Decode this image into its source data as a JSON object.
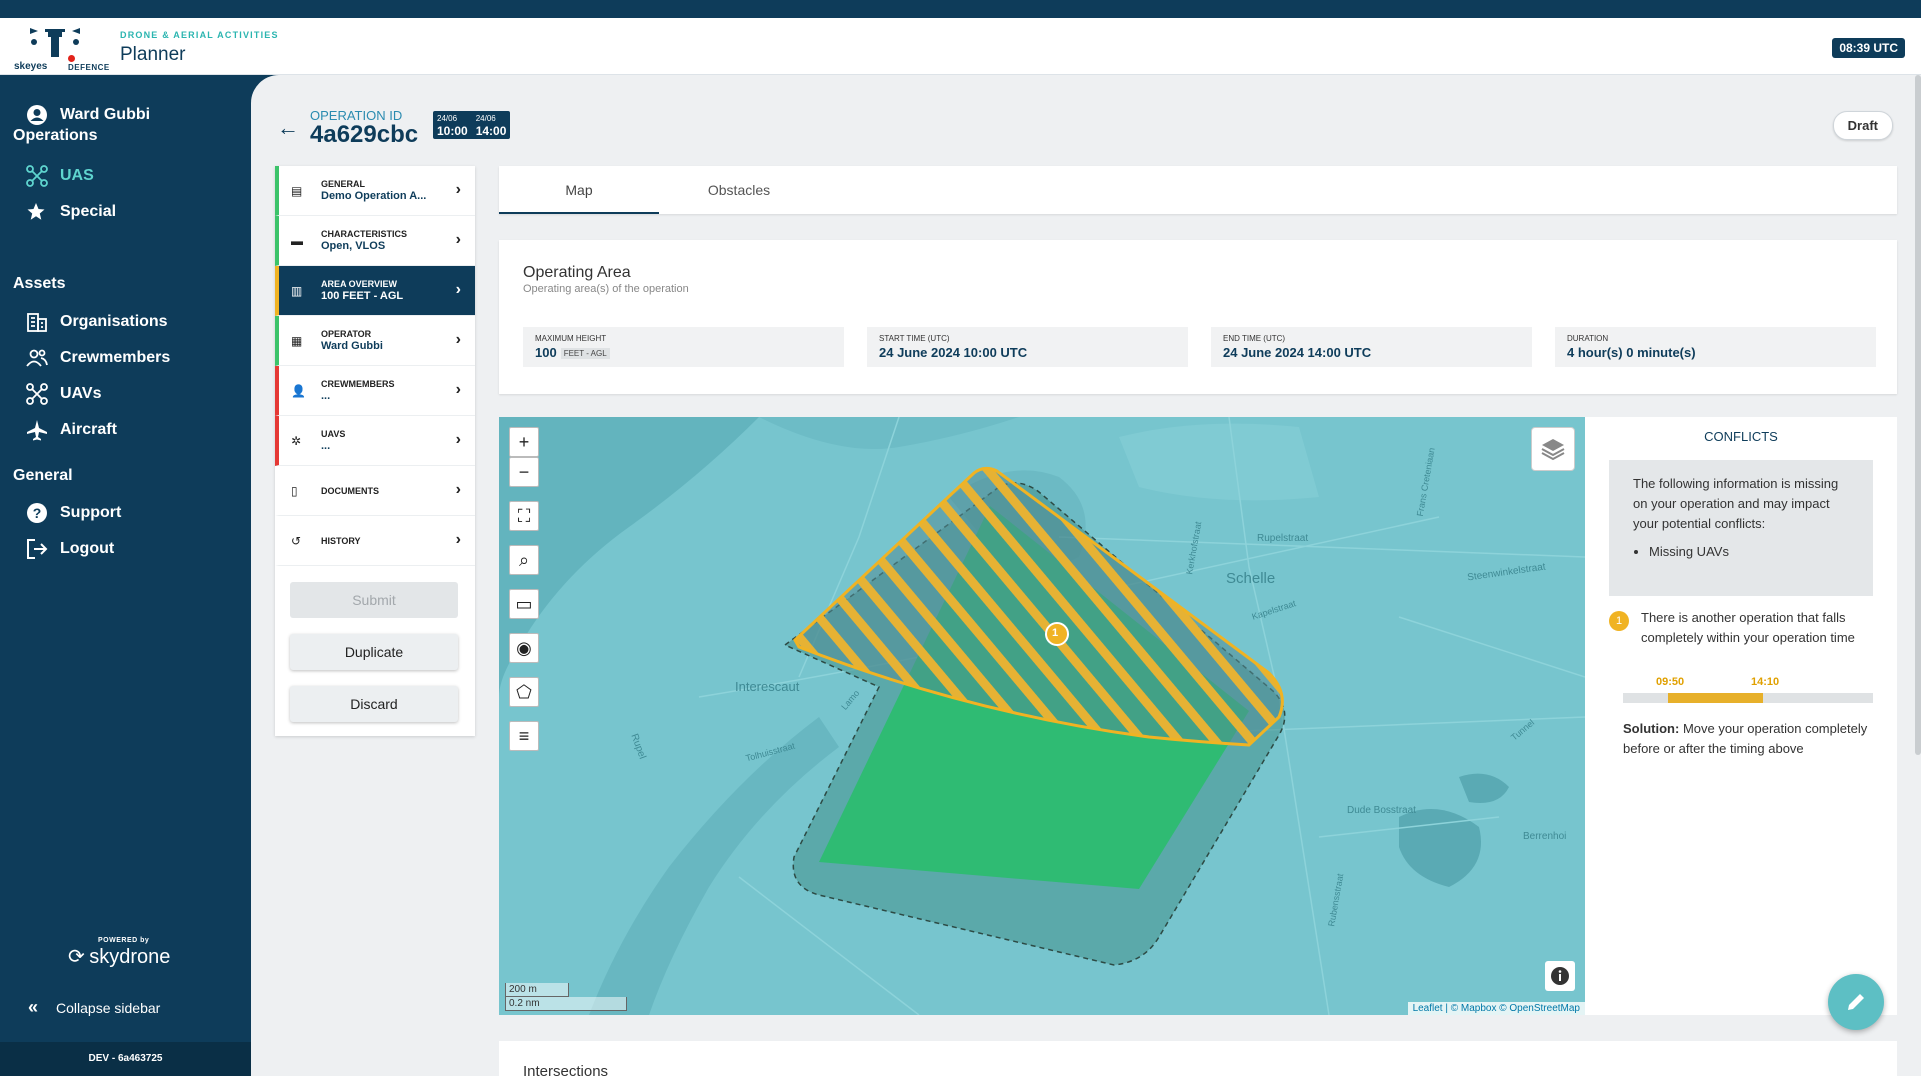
{
  "header": {
    "subtitle": "DRONE & AERIAL ACTIVITIES",
    "title": "Planner",
    "clock": "08:39 UTC",
    "logo_left": "skeyes",
    "logo_right": "DEFENCE"
  },
  "sidebar": {
    "user": "Ward Gubbi",
    "sections": {
      "operations": "Operations",
      "assets": "Assets",
      "general": "General"
    },
    "items": {
      "uas": "UAS",
      "special": "Special",
      "organisations": "Organisations",
      "crewmembers": "Crewmembers",
      "uavs": "UAVs",
      "aircraft": "Aircraft",
      "support": "Support",
      "logout": "Logout"
    },
    "powered_by": "POWERED by",
    "powered_brand": "skydrone",
    "collapse": "Collapse sidebar",
    "dev": "DEV - 6a463725"
  },
  "operation": {
    "id_label": "OPERATION ID",
    "id": "4a629cbc",
    "start_date": "24/06",
    "start_time": "10:00",
    "end_date": "24/06",
    "end_time": "14:00",
    "status": "Draft"
  },
  "steps": [
    {
      "title": "GENERAL",
      "value": "Demo Operation A..."
    },
    {
      "title": "CHARACTERISTICS",
      "value": "Open, VLOS"
    },
    {
      "title": "AREA OVERVIEW",
      "value": "100 FEET - AGL"
    },
    {
      "title": "OPERATOR",
      "value": "Ward Gubbi"
    },
    {
      "title": "CREWMEMBERS",
      "value": "..."
    },
    {
      "title": "UAVS",
      "value": "..."
    },
    {
      "title": "DOCUMENTS",
      "value": ""
    },
    {
      "title": "HISTORY",
      "value": ""
    }
  ],
  "actions": {
    "submit": "Submit",
    "duplicate": "Duplicate",
    "discard": "Discard"
  },
  "tabs": [
    "Map",
    "Obstacles"
  ],
  "operating_area": {
    "title": "Operating Area",
    "subtitle": "Operating area(s) of the operation",
    "max_height_label": "MAXIMUM HEIGHT",
    "max_height": "100",
    "max_height_unit": "FEET - AGL",
    "start_label": "START TIME (UTC)",
    "start": "24 June 2024 10:00 UTC",
    "end_label": "END TIME (UTC)",
    "end": "24 June 2024 14:00 UTC",
    "duration_label": "DURATION",
    "duration": "4 hour(s) 0 minute(s)"
  },
  "map": {
    "labels": {
      "schelle": "Schelle",
      "interescaut": "Interescaut",
      "rupelstraat": "Rupelstraat",
      "steenwinkel": "Steenwinkelstraat",
      "kapel": "Kapelstraat",
      "tolhuis": "Tolhuisstraat",
      "dude": "Dude Bosstraat",
      "berren": "Berrenhoi",
      "rupel": "Rupel",
      "tunnel": "Tunnel",
      "frans": "Frans Creteniaan",
      "kerkhof": "Kerkhofstraat",
      "rubens": "Rubensstraat",
      "eiland": "Eiland",
      "lamo": "Lamo"
    },
    "conflict_marker": "1",
    "scale_m": "200 m",
    "scale_nm": "0.2 nm",
    "attribution_leaflet": "Leaflet",
    "attribution_rest": "| © Mapbox © OpenStreetMap"
  },
  "conflicts": {
    "title": "CONFLICTS",
    "missing_text": "The following information is missing on your operation and may impact your potential conflicts:",
    "missing_items": [
      "Missing UAVs"
    ],
    "conflict_number": "1",
    "message": "There is another operation that falls completely within your operation time",
    "timeline_start": "09:50",
    "timeline_end": "14:10",
    "overlap_start_fraction": 0.18,
    "overlap_end_fraction": 0.56,
    "solution_label": "Solution:",
    "solution_text": "Move your operation completely before or after the timing above"
  },
  "intersections_title": "Intersections"
}
